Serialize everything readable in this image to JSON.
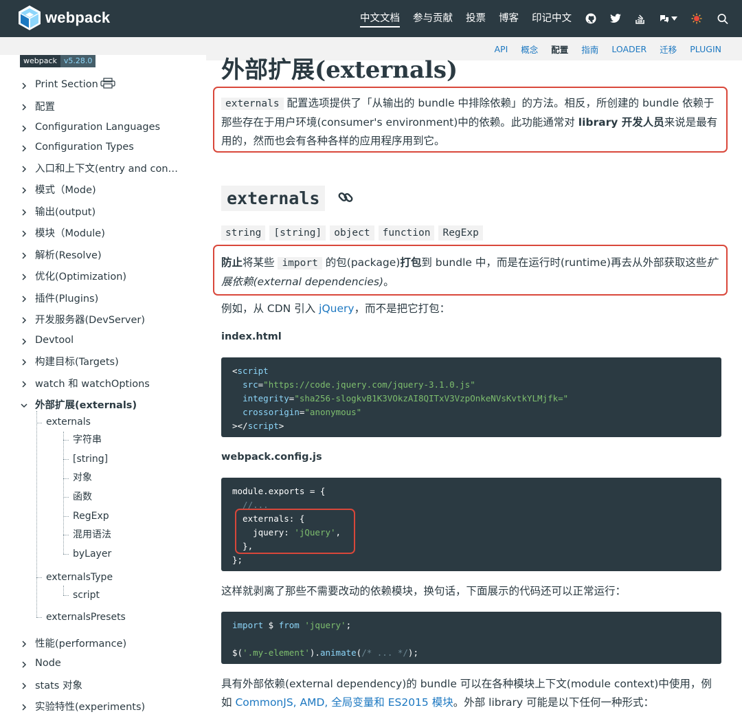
{
  "header": {
    "brand": "webpack",
    "nav": [
      "中文文档",
      "参与贡献",
      "投票",
      "博客",
      "印记中文"
    ],
    "nav_icons": [
      "github-icon",
      "twitter-icon",
      "stackoverflow-icon",
      "language-icon",
      "webpack-doc-icon",
      "search-icon"
    ]
  },
  "subnav": [
    "API",
    "概念",
    "配置",
    "指南",
    "LOADER",
    "迁移",
    "PLUGIN"
  ],
  "sidebar": {
    "version_left": "webpack",
    "version_right": "v5.28.0",
    "items": [
      "Print Section",
      "配置",
      "Configuration Languages",
      "Configuration Types",
      "入口和上下文(entry and con…",
      "模式（Mode)",
      "输出(output)",
      "模块（Module)",
      "解析(Resolve)",
      "优化(Optimization)",
      "插件(Plugins)",
      "开发服务器(DevServer)",
      "Devtool",
      "构建目标(Targets)",
      "watch 和 watchOptions",
      "外部扩展(externals)",
      "性能(performance)",
      "Node",
      "stats 对象",
      "实验特性(experiments)"
    ],
    "sub": {
      "externals": "externals",
      "externals_children": [
        "字符串",
        "[string]",
        "对象",
        "函数",
        "RegExp",
        "混用语法",
        "byLayer"
      ],
      "externalsType": "externalsType",
      "externalsType_children": [
        "script"
      ],
      "externalsPresets": "externalsPresets"
    }
  },
  "content": {
    "title": "外部扩展(externals)",
    "intro": {
      "code": "externals",
      "t1": " 配置选项提供了「从输出的 bundle 中排除依赖」的方法。相反，所创建的 bundle 依赖于那些存在于用户环境(consumer's environment)中的依赖。此功能通常对 ",
      "bold": "library 开发人员",
      "t2": "来说是最有用的，然而也会有各种各样的应用程序用到它。"
    },
    "h2": "externals",
    "types": [
      "string",
      "[string]",
      "object",
      "function",
      "RegExp"
    ],
    "prevent": {
      "b1": "防止",
      "t1": "将某些 ",
      "code": "import",
      "t2": " 的包(package)",
      "b2": "打包",
      "t3": "到 bundle 中，而是在运行时(runtime)再去从外部获取这些",
      "i1": "扩展依赖(external dependencies)",
      "t4": "。"
    },
    "example": {
      "t1": "例如，从 CDN 引入 ",
      "link": "jQuery",
      "t2": "，而不是把它打包："
    },
    "file1": "index.html",
    "code1": {
      "l1_open": "<",
      "l1_tag": "script",
      "l2_attr": "src",
      "l2_val": "\"https://code.jquery.com/jquery-3.1.0.js\"",
      "l3_attr": "integrity",
      "l3_val": "\"sha256-slogkvB1K3VOkzAI8QITxV3VzpOnkeNVsKvtkYLMjfk=\"",
      "l4_attr": "crossorigin",
      "l4_val": "\"anonymous\"",
      "l5_open": "></",
      "l5_tag": "script",
      "l5_close": ">"
    },
    "file2": "webpack.config.js",
    "code2": {
      "l1": "module.exports = {",
      "l2": "  //...",
      "l3": "  externals: {",
      "l4_key": "    jquery: ",
      "l4_val": "'jQuery'",
      "l4_end": ",",
      "l5": "  },",
      "l6": "};"
    },
    "after_text": "这样就剥离了那些不需要改动的依赖模块，换句话，下面展示的代码还可以正常运行：",
    "code3": {
      "l1_kw": "import",
      "l1_mid": " $ ",
      "l1_kw2": "from",
      "l1_sp": " ",
      "l1_str": "'jquery'",
      "l1_end": ";",
      "l3_a": "$(",
      "l3_str": "'.my-element'",
      "l3_b": ").",
      "l3_fn": "animate",
      "l3_c": "(",
      "l3_com": "/* ... */",
      "l3_d": ");"
    },
    "final": {
      "t1": "具有外部依赖(external dependency)的 bundle 可以在各种模块上下文(module context)中使用，例如 ",
      "link": "CommonJS, AMD, 全局变量和 ES2015 模块",
      "t2": "。外部 library 可能是以下任何一种形式："
    }
  },
  "colors": {
    "header_bg": "#2b3a42",
    "accent_blue": "#1d78c1",
    "highlight_red": "#d9473a",
    "code_bg": "#2b3a42"
  }
}
